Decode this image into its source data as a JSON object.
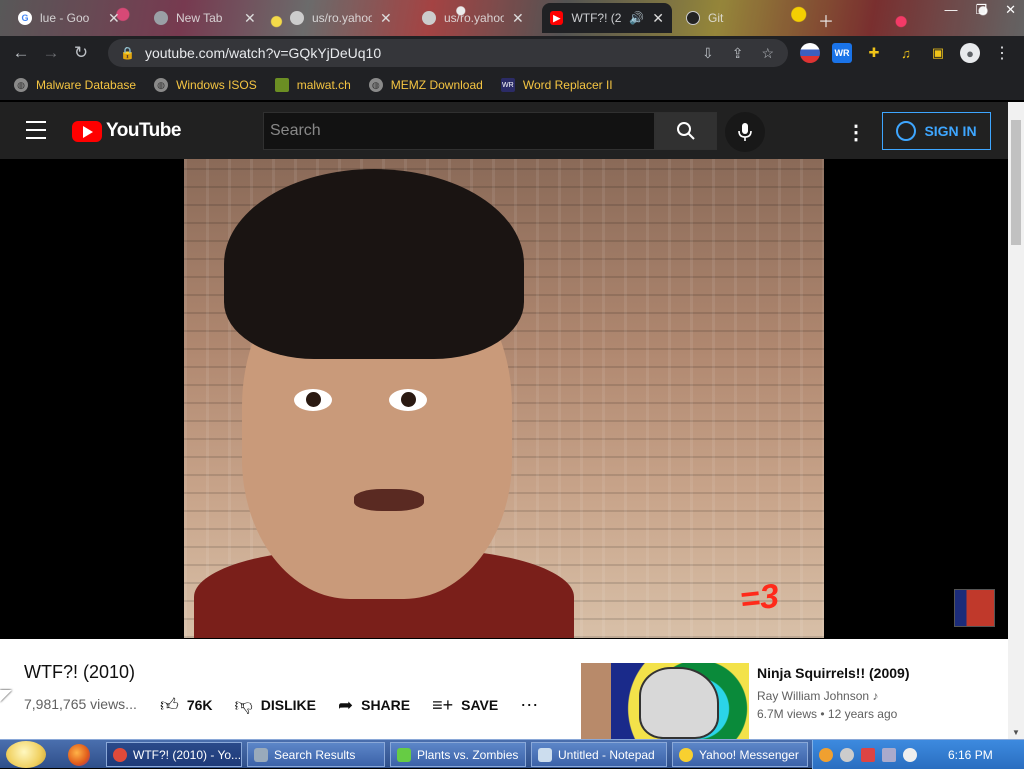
{
  "browser": {
    "tabs": [
      {
        "label": "lue - Goo",
        "favicon": "google-icon"
      },
      {
        "label": "New Tab",
        "favicon": "chrome-icon"
      },
      {
        "label": "us/ro.yahoo",
        "favicon": "page-icon"
      },
      {
        "label": "us/ro.yahoo",
        "favicon": "page-icon"
      },
      {
        "label": "WTF?! (2",
        "favicon": "youtube-icon",
        "active": true,
        "audio": true
      },
      {
        "label": "Git",
        "favicon": "github-icon"
      }
    ],
    "url": "youtube.com/watch?v=GQkYjDeUq10",
    "bookmarks": [
      {
        "label": "Malware Database"
      },
      {
        "label": "Windows ISOS"
      },
      {
        "label": "malwat.ch"
      },
      {
        "label": "MEMZ Download"
      },
      {
        "label": "Word Replacer II"
      }
    ]
  },
  "youtube": {
    "logo_text": "YouTube",
    "search_placeholder": "Search",
    "signin_label": "SIGN IN",
    "video": {
      "overlay_text": "=3",
      "title": "WTF?! (2010)",
      "views": "7,981,765 views...",
      "likes": "76K",
      "dislike_label": "DISLIKE",
      "share_label": "SHARE",
      "save_label": "SAVE"
    },
    "related": {
      "title": "Ninja Squirrels!! (2009)",
      "channel": "Ray William Johnson",
      "views": "6.7M views",
      "age": "12 years ago"
    }
  },
  "taskbar": {
    "tasks": [
      {
        "label": "WTF?! (2010) - Yo...",
        "icon": "chrome-icon",
        "active": true
      },
      {
        "label": "Search Results",
        "icon": "search-icon"
      },
      {
        "label": "Plants vs. Zombies",
        "icon": "pvz-icon"
      },
      {
        "label": "Untitled - Notepad",
        "icon": "notepad-icon"
      },
      {
        "label": "Yahoo! Messenger",
        "icon": "yahoo-messenger-icon"
      }
    ],
    "clock": "6:16 PM"
  }
}
